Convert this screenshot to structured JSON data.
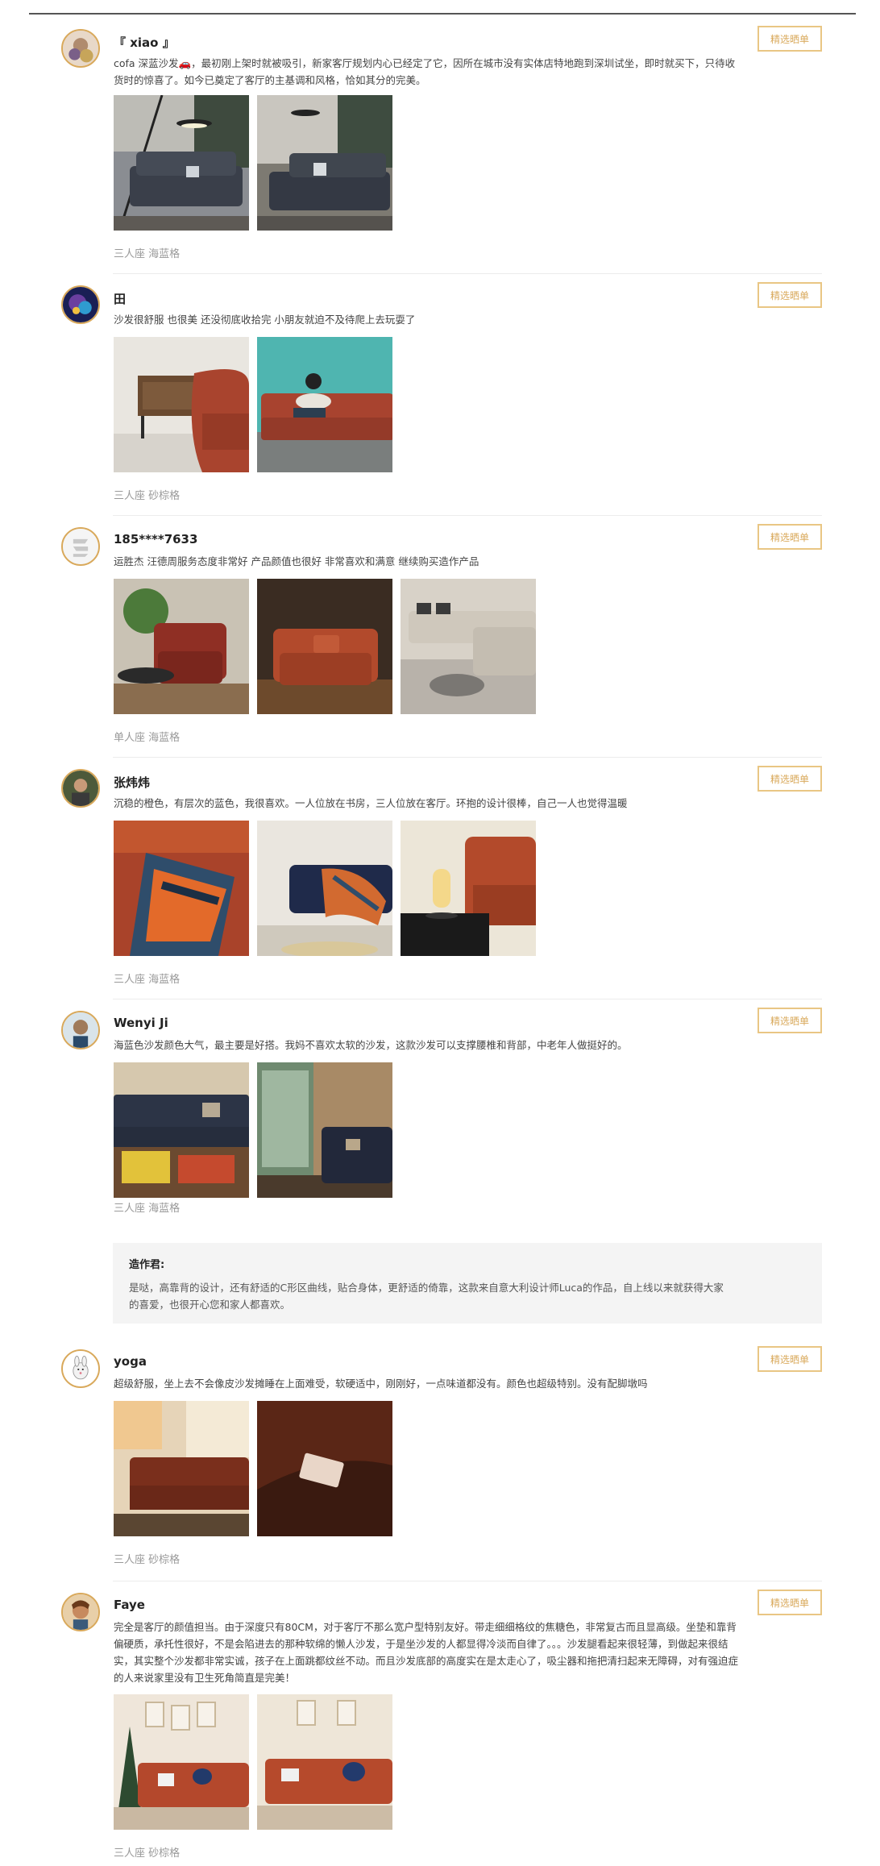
{
  "badge_label": "精选晒单",
  "reviews": [
    {
      "name": "『 xiao 』",
      "text": "cofa 深蓝沙发🚗，最初刚上架时就被吸引，新家客厅规划内心已经定了它，因所在城市没有实体店特地跑到深圳试坐，即时就买下，只待收货时的惊喜了。如今已奠定了客厅的主基调和风格，恰如其分的完美。",
      "variant": "三人座 海蓝格",
      "photos": [
        "photo-navy-sofa-lamp",
        "photo-navy-sofa-window"
      ]
    },
    {
      "name": "田",
      "text": "沙发很舒服 也很美 还没彻底收拾完 小朋友就迫不及待爬上去玩耍了",
      "variant": "三人座 砂棕格",
      "photos": [
        "photo-rust-sofa-cabinet",
        "photo-child-on-sofa"
      ]
    },
    {
      "name": "185****7633",
      "text": "运胜杰 汪德周服务态度非常好 产品颜值也很好 非常喜欢和满意 继续购买造作产品",
      "variant": "单人座 海蓝格",
      "photos": [
        "photo-rust-armchair-plant",
        "photo-rust-armchair-floor",
        "photo-grey-sectional"
      ]
    },
    {
      "name": "张炜炜",
      "text": "沉稳的橙色，有层次的蓝色，我很喜欢。一人位放在书房，三人位放在客厅。环抱的设计很棒，自己一人也觉得温暖",
      "variant": "三人座 海蓝格",
      "photos": [
        "photo-armchair-blanket",
        "photo-navy-sofa-blanket",
        "photo-armchair-lamp"
      ]
    },
    {
      "name": "Wenyi Ji",
      "text": "海蓝色沙发颜色大气，最主要是好搭。我妈不喜欢太软的沙发，这款沙发可以支撑腰椎和背部，中老年人做挺好的。",
      "variant": "三人座 海蓝格",
      "photos": [
        "photo-navy-sofa-magazines",
        "photo-navy-sofa-room"
      ]
    },
    {
      "name": "yoga",
      "text": "超级舒服，坐上去不会像皮沙发摊睡在上面难受，软硬适中，刚刚好，一点味道都没有。颜色也超级特别。没有配脚墩吗",
      "variant": "三人座 砂棕格",
      "photos": [
        "photo-rust-sofa-window",
        "photo-rust-cushion-closeup"
      ]
    },
    {
      "name": "Faye",
      "text": "完全是客厅的颜值担当。由于深度只有80CM，对于客厅不那么宽户型特别友好。带走细细格纹的焦糖色，非常复古而且显高级。坐垫和靠背偏硬质，承托性很好，不是会陷进去的那种软绵的懒人沙发，于是坐沙发的人都显得冷淡而自律了。。。沙发腿看起来很轻薄，到做起来很结实，其实整个沙发都非常实诚，孩子在上面跳都纹丝不动。而且沙发底部的高度实在是太走心了，吸尘器和拖把清扫起来无障碍，对有强迫症的人来说家里没有卫生死角简直是完美！",
      "variant": "三人座 砂棕格",
      "photos": [
        "photo-rust-sofa-tree",
        "photo-rust-sofa-penguin"
      ]
    }
  ],
  "designer": {
    "title": "造作君:",
    "text": "是哒，高靠背的设计，还有舒适的C形区曲线，贴合身体，更舒适的倚靠，这款来自意大利设计师Luca的作品，自上线以来就获得大家的喜爱，也很开心您和家人都喜欢。"
  }
}
